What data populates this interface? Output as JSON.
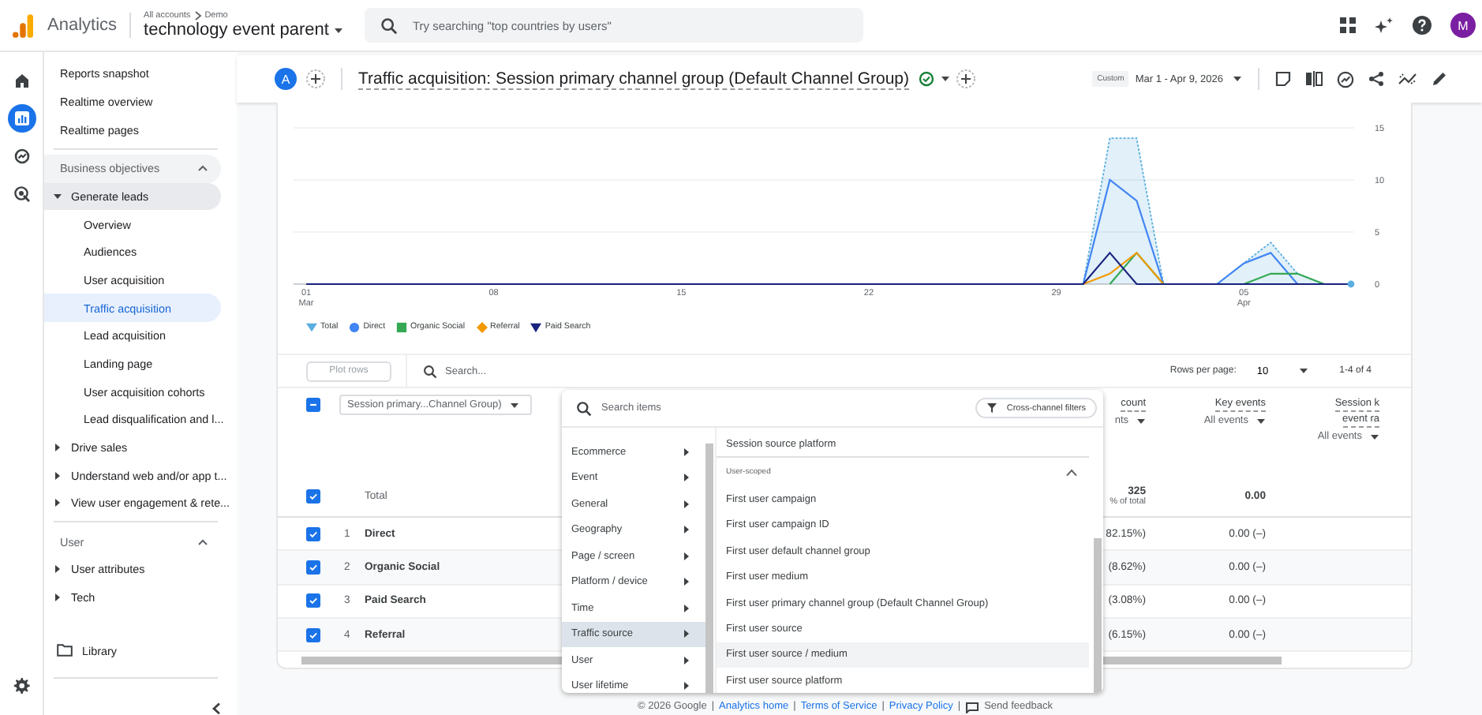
{
  "header": {
    "product": "Analytics",
    "breadcrumb": [
      "All accounts",
      "Demo"
    ],
    "property": "technology event parent",
    "search_placeholder": "Try searching \"top countries by users\"",
    "avatar": "M"
  },
  "rail": [
    {
      "kind": "home",
      "selected": false
    },
    {
      "kind": "reports",
      "selected": true
    },
    {
      "kind": "explore",
      "selected": false
    },
    {
      "kind": "advertising",
      "selected": false
    }
  ],
  "sidebar": {
    "top_items": [
      {
        "label": "Reports snapshot",
        "selected": false
      },
      {
        "label": "Realtime overview",
        "selected": false
      },
      {
        "label": "Realtime pages",
        "selected": false
      }
    ],
    "sections": [
      {
        "title": "Business objectives",
        "expanded": true,
        "hovered": true,
        "items": [
          {
            "label": "Generate leads",
            "expanded": true,
            "children": [
              {
                "label": "Overview",
                "selected": false
              },
              {
                "label": "Audiences",
                "selected": false
              },
              {
                "label": "User acquisition",
                "selected": false
              },
              {
                "label": "Traffic acquisition",
                "selected": true
              },
              {
                "label": "Lead acquisition",
                "selected": false
              },
              {
                "label": "Landing page",
                "selected": false
              },
              {
                "label": "User acquisition cohorts",
                "selected": false
              },
              {
                "label": "Lead disqualification and l...",
                "selected": false
              }
            ]
          },
          {
            "label": "Drive sales",
            "expanded": false
          },
          {
            "label": "Understand web and/or app t...",
            "expanded": false
          },
          {
            "label": "View user engagement & rete...",
            "expanded": false
          }
        ]
      },
      {
        "title": "User",
        "expanded": true,
        "hovered": false,
        "items": [
          {
            "label": "User attributes",
            "expanded": false
          },
          {
            "label": "Tech",
            "expanded": false
          }
        ]
      }
    ],
    "library": "Library"
  },
  "report": {
    "comparison": "A",
    "title": "Traffic acquisition: Session primary channel group (Default Channel Group)",
    "date_label": "Custom",
    "date_range": "Mar 1 - Apr 9, 2026"
  },
  "chart": {
    "chart_data": {
      "type": "line",
      "ylim": [
        0,
        15
      ],
      "yticks": [
        0,
        5,
        10,
        15
      ],
      "categories": [
        "01\nMar",
        null,
        null,
        null,
        null,
        null,
        null,
        "08",
        null,
        null,
        null,
        null,
        null,
        null,
        "15",
        null,
        null,
        null,
        null,
        null,
        null,
        "22",
        null,
        null,
        null,
        null,
        null,
        null,
        "29",
        null,
        null,
        null,
        null,
        null,
        null,
        "05\nApr",
        null,
        null,
        null,
        null
      ],
      "series": [
        {
          "name": "Total",
          "color": "#5aaee0",
          "line_style": "dashed",
          "values": [
            null,
            null,
            null,
            null,
            null,
            null,
            null,
            null,
            null,
            null,
            null,
            null,
            null,
            null,
            null,
            null,
            null,
            null,
            null,
            null,
            null,
            null,
            null,
            null,
            null,
            null,
            null,
            null,
            null,
            0,
            14,
            14,
            0,
            null,
            0,
            2,
            4,
            1,
            0,
            null
          ]
        },
        {
          "name": "Direct",
          "color": "#4285f4",
          "values": [
            null,
            null,
            null,
            null,
            null,
            null,
            null,
            null,
            null,
            null,
            null,
            null,
            null,
            null,
            null,
            null,
            null,
            null,
            null,
            null,
            null,
            null,
            null,
            null,
            null,
            null,
            null,
            null,
            null,
            0,
            10,
            8,
            0,
            null,
            0,
            2,
            3,
            0,
            null,
            null
          ]
        },
        {
          "name": "Organic Social",
          "color": "#34a853",
          "values": [
            null,
            null,
            null,
            null,
            null,
            null,
            null,
            null,
            null,
            null,
            null,
            null,
            null,
            null,
            null,
            null,
            null,
            null,
            null,
            null,
            null,
            null,
            null,
            null,
            null,
            null,
            null,
            null,
            null,
            null,
            0,
            3,
            0,
            null,
            null,
            0,
            1,
            1,
            0,
            null
          ]
        },
        {
          "name": "Referral",
          "color": "#f29900",
          "values": [
            null,
            null,
            null,
            null,
            null,
            null,
            null,
            null,
            null,
            null,
            null,
            null,
            null,
            null,
            null,
            null,
            null,
            null,
            null,
            null,
            null,
            null,
            null,
            null,
            null,
            null,
            null,
            null,
            null,
            0,
            1,
            3,
            0,
            null,
            null,
            null,
            null,
            null,
            null,
            null
          ]
        },
        {
          "name": "Paid Search",
          "color": "#1a237e",
          "values": [
            0,
            0,
            0,
            0,
            0,
            0,
            0,
            0,
            0,
            0,
            0,
            0,
            0,
            0,
            0,
            0,
            0,
            0,
            0,
            0,
            0,
            0,
            0,
            0,
            0,
            0,
            0,
            0,
            0,
            0,
            3,
            0,
            0,
            0,
            0,
            0,
            0,
            0,
            0,
            0
          ]
        }
      ]
    }
  },
  "table": {
    "plot_rows": {
      "label": "Plot rows",
      "disabled": true
    },
    "search_placeholder": "Search...",
    "rows_per_page_label": "Rows per page:",
    "rows_per_page": "10",
    "pagination": "1-4 of 4",
    "select_all": {
      "indeterminate": true
    },
    "dimension": "Session primary...Channel Group)",
    "columns": [
      {
        "title": [
          "count"
        ],
        "filter": "nts"
      },
      {
        "title": [
          "Key events"
        ],
        "filter": "All events"
      },
      {
        "title": [
          "Session k",
          "event ra"
        ],
        "filter": "All events"
      }
    ],
    "total": {
      "checked": true,
      "label": "Total",
      "cells": [
        {
          "value": "325",
          "note": "% of total"
        },
        {
          "value": "0.00"
        }
      ]
    },
    "rows": [
      {
        "checked": true,
        "rank": "1",
        "name": "Direct",
        "cells": [
          "82.15%)",
          "0.00 (–)"
        ]
      },
      {
        "checked": true,
        "rank": "2",
        "name": "Organic Social",
        "cells": [
          "(8.62%)",
          "0.00 (–)"
        ]
      },
      {
        "checked": true,
        "rank": "3",
        "name": "Paid Search",
        "cells": [
          "(3.08%)",
          "0.00 (–)"
        ]
      },
      {
        "checked": true,
        "rank": "4",
        "name": "Referral",
        "cells": [
          "(6.15%)",
          "0.00 (–)"
        ]
      }
    ]
  },
  "menu": {
    "search_placeholder": "Search items",
    "filter_button": "Cross-channel filters",
    "categories": [
      {
        "label": "Ecommerce",
        "selected": false
      },
      {
        "label": "Event",
        "selected": false
      },
      {
        "label": "General",
        "selected": false
      },
      {
        "label": "Geography",
        "selected": false
      },
      {
        "label": "Page / screen",
        "selected": false
      },
      {
        "label": "Platform / device",
        "selected": false
      },
      {
        "label": "Time",
        "selected": false
      },
      {
        "label": "Traffic source",
        "selected": true
      },
      {
        "label": "User",
        "selected": false
      },
      {
        "label": "User lifetime",
        "selected": false
      }
    ],
    "items": [
      {
        "kind": "item",
        "label": "Session source platform",
        "selected": false
      },
      {
        "kind": "section",
        "label": "User-scoped",
        "expanded": true
      },
      {
        "kind": "item",
        "label": "First user campaign",
        "selected": false
      },
      {
        "kind": "item",
        "label": "First user campaign ID",
        "selected": false
      },
      {
        "kind": "item",
        "label": "First user default channel group",
        "selected": false
      },
      {
        "kind": "item",
        "label": "First user medium",
        "selected": false
      },
      {
        "kind": "item",
        "label": "First user primary channel group (Default Channel Group)",
        "selected": false
      },
      {
        "kind": "item",
        "label": "First user source",
        "selected": false
      },
      {
        "kind": "item",
        "label": "First user source / medium",
        "selected": true
      },
      {
        "kind": "item",
        "label": "First user source platform",
        "selected": false
      }
    ]
  },
  "footer": {
    "copyright": "© 2026 Google",
    "separator": "|",
    "links": [
      "Analytics home",
      "Terms of Service",
      "Privacy Policy"
    ],
    "feedback": "Send feedback"
  }
}
